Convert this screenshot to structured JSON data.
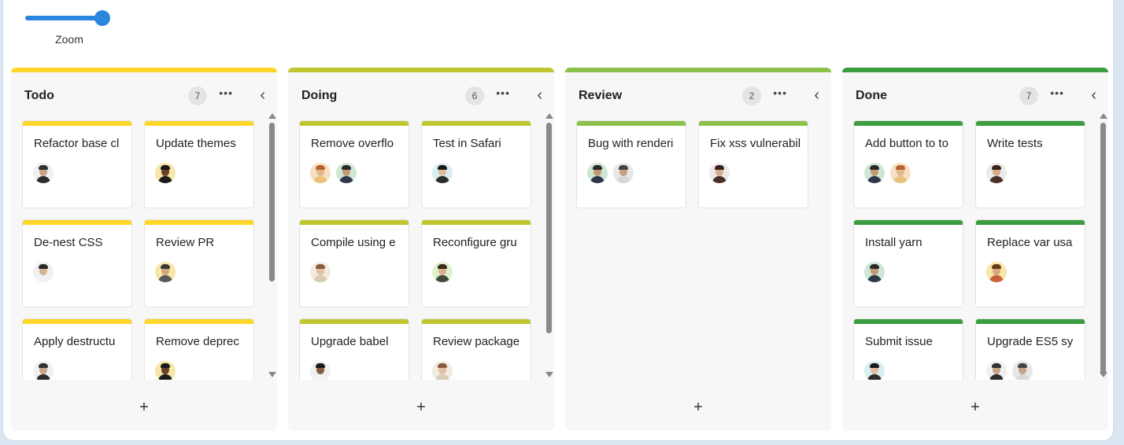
{
  "zoom": {
    "label": "Zoom",
    "level": 1.0
  },
  "add_label": "+",
  "more_label": "•••",
  "collapse_label": "‹",
  "columns": [
    {
      "title": "Todo",
      "count": "7",
      "color": "#ffd628",
      "cards": [
        {
          "title": "Refactor base cl",
          "avatars": [
            "man-1"
          ]
        },
        {
          "title": "Update themes",
          "avatars": [
            "woman-1"
          ]
        },
        {
          "title": "De-nest CSS",
          "avatars": [
            "man-2"
          ]
        },
        {
          "title": "Review PR",
          "avatars": [
            "man-3"
          ]
        },
        {
          "title": "Apply destructu",
          "avatars": [
            "man-1"
          ]
        },
        {
          "title": "Remove deprec",
          "avatars": [
            "woman-1"
          ]
        }
      ]
    },
    {
      "title": "Doing",
      "count": "6",
      "color": "#c0c72e",
      "cards": [
        {
          "title": "Remove overflo",
          "avatars": [
            "woman-2",
            "man-4"
          ]
        },
        {
          "title": "Test in Safari",
          "avatars": [
            "woman-3"
          ]
        },
        {
          "title": "Compile using e",
          "avatars": [
            "woman-4"
          ]
        },
        {
          "title": "Reconfigure gru",
          "avatars": [
            "man-5"
          ]
        },
        {
          "title": "Upgrade babel",
          "avatars": [
            "man-6"
          ]
        },
        {
          "title": "Review package",
          "avatars": [
            "woman-4"
          ]
        }
      ]
    },
    {
      "title": "Review",
      "count": "2",
      "color": "#8dc24a",
      "cards": [
        {
          "title": "Bug with renderi",
          "avatars": [
            "man-4",
            "man-7"
          ]
        },
        {
          "title": "Fix xss vulnerabil",
          "avatars": [
            "woman-5"
          ]
        }
      ]
    },
    {
      "title": "Done",
      "count": "7",
      "color": "#3c9c40",
      "cards": [
        {
          "title": "Add button to to",
          "avatars": [
            "man-4",
            "woman-2"
          ]
        },
        {
          "title": "Write tests",
          "avatars": [
            "woman-5"
          ]
        },
        {
          "title": "Install yarn",
          "avatars": [
            "man-4"
          ]
        },
        {
          "title": "Replace var usa",
          "avatars": [
            "woman-6"
          ]
        },
        {
          "title": "Submit issue",
          "avatars": [
            "woman-3"
          ]
        },
        {
          "title": "Upgrade ES5 sy",
          "avatars": [
            "man-1",
            "man-7"
          ]
        }
      ]
    }
  ]
}
